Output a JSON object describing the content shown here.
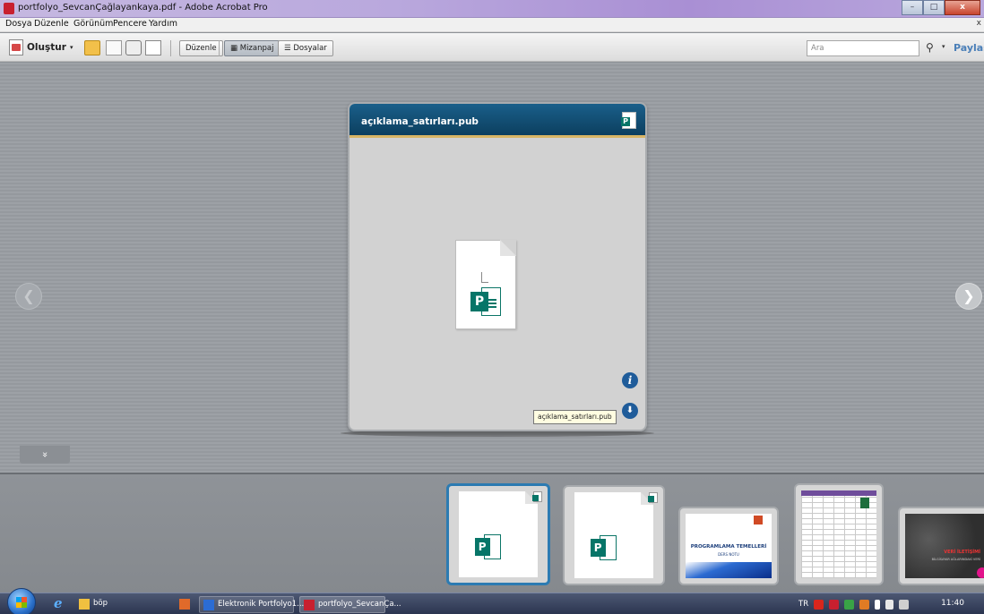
{
  "window": {
    "title": "portfolyo_SevcanÇağlayankaya.pdf - Adobe Acrobat Pro",
    "minimize": "–",
    "maximize": "□",
    "close": "x"
  },
  "menu": {
    "items": [
      "Dosya",
      "Düzenle",
      "Görünüm",
      "Pencere",
      "Yardım"
    ],
    "close_doc": "x"
  },
  "toolbar": {
    "create_label": "Oluştur",
    "create_caret": "▾",
    "edit_label": "Düzenle",
    "layout_label": "Mizanpaj",
    "files_label": "Dosyalar",
    "search_placeholder": "Ara",
    "search_caret": "▾",
    "share_label": "Paylaş"
  },
  "viewer": {
    "card_title": "açıklama_satırları.pub",
    "tooltip": "açıklama_satırları.pub",
    "info_glyph": "i",
    "download_glyph": "⬇",
    "prev_glyph": "❮",
    "next_glyph": "❯",
    "collapse_glyph": "»"
  },
  "thumbnails": {
    "ppt_title": "PROGRAMLAMA TEMELLERİ",
    "ppt_sub": "DERS NOTU",
    "dark_title": "VERİ İLETİŞİMİ",
    "dark_sub": "BİLGİSAYAR AĞLARINDAKİ VERİ"
  },
  "taskbar": {
    "tasks": [
      {
        "label": "böp",
        "color": "#f0c040"
      },
      {
        "label": "",
        "color": "#e06a2a"
      },
      {
        "label": "Elektronik Portfolyo1...",
        "color": "#2b6cd4"
      },
      {
        "label": "portfolyo_SevcanÇa...",
        "color": "#c8202f"
      }
    ],
    "language": "TR",
    "clock": "11:40",
    "tray_colors": [
      "#d9261c",
      "#c8202f",
      "#39a346",
      "#e07b24",
      "#ffffff",
      "#e8e8e8",
      "#cfcfcf"
    ]
  },
  "colors": {
    "card_header": "#0c3f5f",
    "accent_border": "#d8b565",
    "selected_thumb": "#2c7bb2",
    "publisher_green": "#077568"
  }
}
